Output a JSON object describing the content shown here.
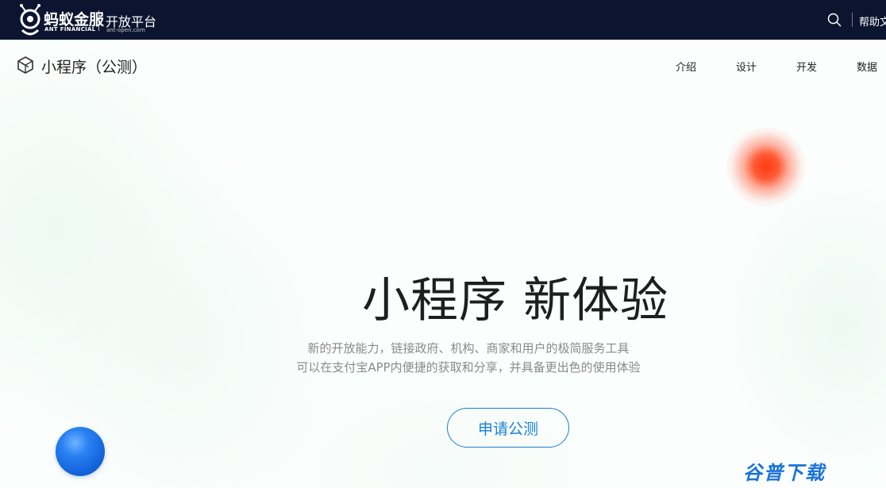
{
  "topbar": {
    "brand_cn": "蚂蚁金服",
    "brand_en": "ANT FINANCIAL",
    "platform_cn": "开放平台",
    "platform_en": "ant-open.com",
    "help_label": "帮助文",
    "search_icon": "search-icon"
  },
  "subnav": {
    "title": "小程序（公测）",
    "icon": "cube-outline-icon",
    "items": [
      "介绍",
      "设计",
      "开发",
      "数据"
    ]
  },
  "hero": {
    "title": "小程序 新体验",
    "desc_line1": "新的开放能力，链接政府、机构、商家和用户的极简服务工具",
    "desc_line2": "可以在支付宝APP内便捷的获取和分享，并具备更出色的使用体验",
    "cta_label": "申请公测"
  },
  "watermark": "谷普下载",
  "colors": {
    "topbar_bg": "#0b1530",
    "accent_blue": "#1a7fd6",
    "orb_red": "#ff3a12",
    "orb_blue": "#1466dc"
  }
}
